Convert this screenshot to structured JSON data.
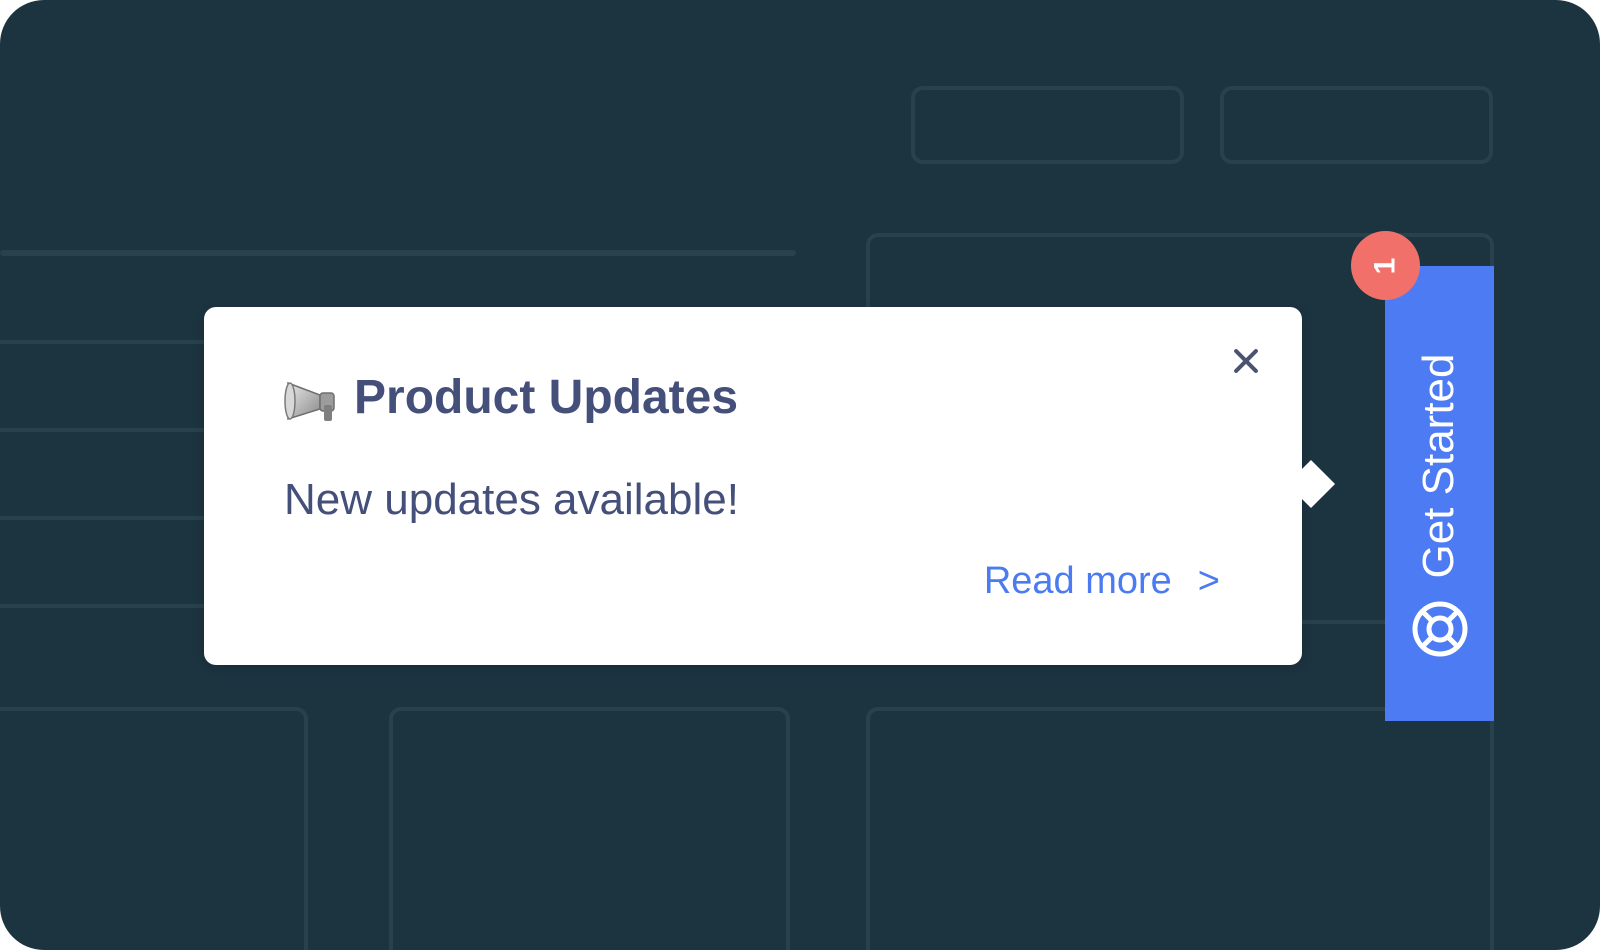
{
  "popup": {
    "title": "Product Updates",
    "title_icon": "megaphone-icon",
    "message": "New updates available!",
    "link_label": "Read more",
    "link_chevron": ">",
    "close_icon": "close-icon"
  },
  "side_tab": {
    "label": "Get Started",
    "icon": "lifebuoy-icon",
    "badge_count": "1"
  },
  "colors": {
    "background": "#1c3340",
    "wireframe": "#28414d",
    "accent": "#4d7bf3",
    "badge": "#f1716a",
    "title_text": "#45507a",
    "link": "#4a7bf0"
  }
}
